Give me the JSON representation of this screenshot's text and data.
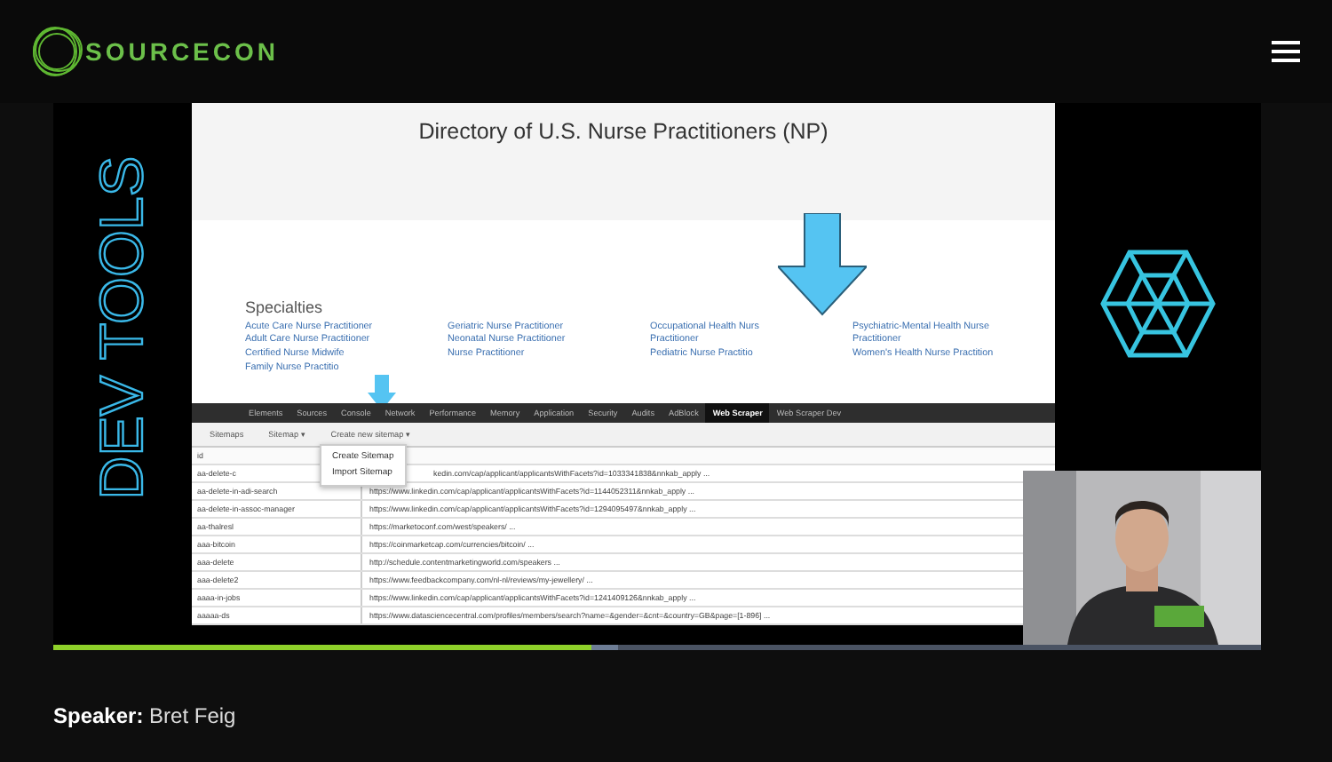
{
  "header": {
    "logo": "SOURCECON"
  },
  "slide": {
    "side_title": "DEV TOOLS",
    "page": {
      "title": "Directory of U.S. Nurse Practitioners (NP)",
      "section": "Specialties",
      "columns": [
        [
          "Acute Care Nurse Practitioner",
          "Adult Care Nurse Practitioner",
          "Certified Nurse Midwife",
          "Family Nurse Practitio"
        ],
        [
          "Geriatric Nurse Practitioner",
          "Neonatal Nurse Practitioner",
          "Nurse Practitioner"
        ],
        [
          "Occupational Health Nurs",
          "Practitioner",
          "Pediatric Nurse Practitio"
        ],
        [
          "Psychiatric-Mental Health Nurse",
          "Practitioner",
          "Women's Health Nurse Practition"
        ]
      ]
    },
    "devtools": {
      "tabs": [
        {
          "label": "Elements",
          "selected": false
        },
        {
          "label": "Sources",
          "selected": false
        },
        {
          "label": "Console",
          "selected": false
        },
        {
          "label": "Network",
          "selected": false
        },
        {
          "label": "Performance",
          "selected": false
        },
        {
          "label": "Memory",
          "selected": false
        },
        {
          "label": "Application",
          "selected": false
        },
        {
          "label": "Security",
          "selected": false
        },
        {
          "label": "Audits",
          "selected": false
        },
        {
          "label": "AdBlock",
          "selected": false
        },
        {
          "label": "Web Scraper",
          "selected": true
        },
        {
          "label": "Web Scraper Dev",
          "selected": false
        }
      ],
      "toolbar": [
        "Sitemaps",
        "Sitemap ▾",
        "Create new sitemap ▾"
      ],
      "menu": [
        "Create Sitemap",
        "Import Sitemap"
      ],
      "id_header": "id",
      "rows": [
        {
          "id": "aa-delete-c",
          "url": "kedin.com/cap/applicant/applicantsWithFacets?id=1033341838&nnkab_apply ..."
        },
        {
          "id": "aa-delete-in-adi-search",
          "url": "https://www.linkedin.com/cap/applicant/applicantsWithFacets?id=1144052311&nnkab_apply ..."
        },
        {
          "id": "aa-delete-in-assoc-manager",
          "url": "https://www.linkedin.com/cap/applicant/applicantsWithFacets?id=1294095497&nnkab_apply ..."
        },
        {
          "id": "aa-thalresl",
          "url": "https://marketoconf.com/west/speakers/ ..."
        },
        {
          "id": "aaa-bitcoin",
          "url": "https://coinmarketcap.com/currencies/bitcoin/ ..."
        },
        {
          "id": "aaa-delete",
          "url": "http://schedule.contentmarketingworld.com/speakers ..."
        },
        {
          "id": "aaa-delete2",
          "url": "https://www.feedbackcompany.com/nl-nl/reviews/my-jewellery/ ..."
        },
        {
          "id": "aaaa-in-jobs",
          "url": "https://www.linkedin.com/cap/applicant/applicantsWithFacets?id=1241409126&nnkab_apply ..."
        },
        {
          "id": "aaaaa-ds",
          "url": "https://www.datasciencecentral.com/profiles/members/search?name=&gender=&cnt=&country=GB&page=[1-896] ..."
        }
      ]
    }
  },
  "video": {
    "played": {
      "level": 0.445
    },
    "buffered": {
      "level": 0.467
    }
  },
  "speaker": {
    "label": "Speaker:",
    "name": "Bret Feig"
  }
}
